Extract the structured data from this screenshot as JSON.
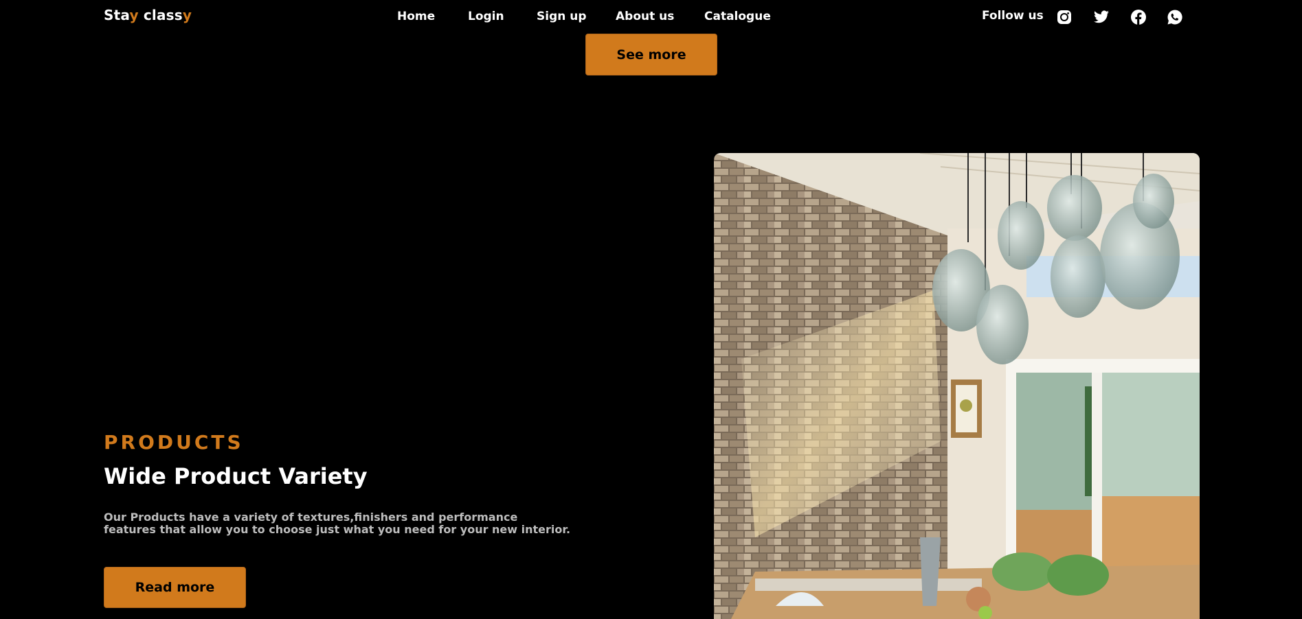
{
  "brand": {
    "part1": "Sta",
    "accent1": "y",
    "part2": " class",
    "accent2": "y"
  },
  "nav": {
    "items": [
      "Home",
      "Login",
      "Sign up",
      "About us",
      "Catalogue"
    ]
  },
  "social": {
    "follow_label": "Follow us",
    "icons": [
      "instagram-icon",
      "twitter-icon",
      "facebook-icon",
      "whatsapp-icon"
    ]
  },
  "see_more_label": "See more",
  "products": {
    "eyebrow": "PRODUCTS",
    "heading": "Wide Product Variety",
    "description": "Our Products have a variety of textures,finishers and performance features that allow you to choose just what you need for your new interior.",
    "read_more_label": "Read more"
  },
  "colors": {
    "accent": "#d17a1c",
    "background": "#000000",
    "text": "#ffffff",
    "muted": "#bdbdbd"
  }
}
